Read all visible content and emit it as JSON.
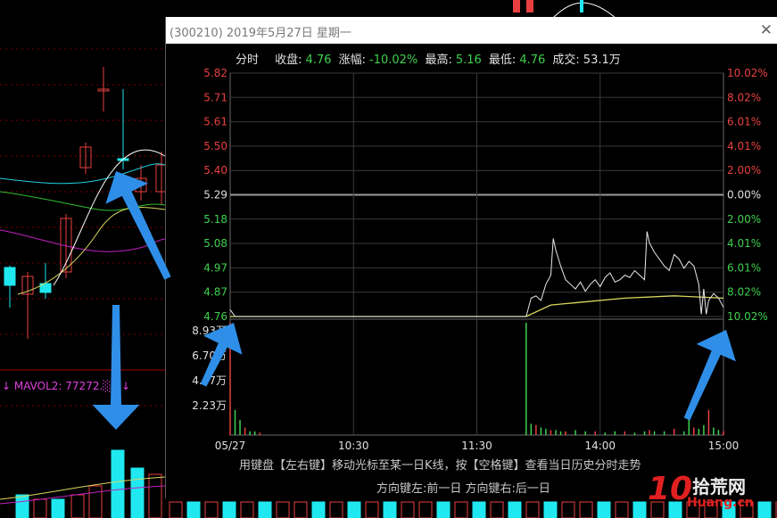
{
  "background": {
    "mavol_label": "↓ MAVOL2: 77272.░0 ↓"
  },
  "popup": {
    "title": "(300210) 2019年5月27日 星期一",
    "close_icon": "close-icon",
    "info": {
      "mode": "分时",
      "close_label": "收盘:",
      "close_value": "4.76",
      "change_label": "涨幅:",
      "change_value": "-10.02%",
      "high_label": "最高:",
      "high_value": "5.16",
      "low_label": "最低:",
      "low_value": "4.76",
      "volume_label": "成交:",
      "volume_value": "53.1万"
    },
    "hint_line1": "用键盘【左右键】移动光标至某一日K线，按【空格键】查看当日历史分时走势",
    "hint_line2": "方向键左:前一日    方向键右:后一日",
    "colors": {
      "up": "#e84040",
      "down": "#3fd04f",
      "neutral": "#e0e0e0",
      "avg_line": "#d8d860",
      "arrow": "#2f8fe8"
    }
  },
  "watermark": {
    "num": "10",
    "cn": "拾荒网",
    "en": "Huang.cn"
  },
  "chart_data": {
    "type": "line",
    "price_ticks_left": [
      "5.82",
      "5.71",
      "5.61",
      "5.50",
      "5.40",
      "5.29",
      "5.18",
      "5.08",
      "4.97",
      "4.87",
      "4.76"
    ],
    "pct_ticks_right": [
      "10.02%",
      "8.02%",
      "6.01%",
      "4.01%",
      "2.00%",
      "0.00%",
      "2.00%",
      "4.01%",
      "6.01%",
      "8.02%",
      "10.02%"
    ],
    "prev_close": 5.29,
    "volume_ticks": [
      "8.93万",
      "6.70万",
      "4.47万",
      "2.23万"
    ],
    "time_ticks": [
      "05/27",
      "10:30",
      "11:30",
      "14:00",
      "15:00"
    ],
    "price_series": [
      [
        0,
        4.79
      ],
      [
        0.01,
        4.76
      ],
      [
        0.6,
        4.76
      ],
      [
        0.61,
        4.84
      ],
      [
        0.62,
        4.85
      ],
      [
        0.63,
        4.83
      ],
      [
        0.64,
        4.9
      ],
      [
        0.65,
        4.94
      ],
      [
        0.655,
        5.1
      ],
      [
        0.66,
        5.05
      ],
      [
        0.67,
        4.98
      ],
      [
        0.68,
        4.92
      ],
      [
        0.69,
        4.9
      ],
      [
        0.7,
        4.88
      ],
      [
        0.71,
        4.91
      ],
      [
        0.72,
        4.87
      ],
      [
        0.73,
        4.9
      ],
      [
        0.74,
        4.92
      ],
      [
        0.75,
        4.89
      ],
      [
        0.76,
        4.93
      ],
      [
        0.77,
        4.95
      ],
      [
        0.78,
        4.91
      ],
      [
        0.79,
        4.92
      ],
      [
        0.8,
        4.94
      ],
      [
        0.81,
        4.93
      ],
      [
        0.82,
        4.96
      ],
      [
        0.83,
        4.94
      ],
      [
        0.84,
        4.92
      ],
      [
        0.845,
        5.13
      ],
      [
        0.85,
        5.08
      ],
      [
        0.86,
        5.04
      ],
      [
        0.87,
        5.01
      ],
      [
        0.88,
        4.98
      ],
      [
        0.89,
        4.96
      ],
      [
        0.9,
        5.03
      ],
      [
        0.91,
        5.01
      ],
      [
        0.92,
        4.97
      ],
      [
        0.93,
        5.0
      ],
      [
        0.94,
        4.98
      ],
      [
        0.95,
        4.9
      ],
      [
        0.955,
        4.77
      ],
      [
        0.96,
        4.88
      ],
      [
        0.965,
        4.77
      ],
      [
        0.97,
        4.83
      ],
      [
        0.98,
        4.86
      ],
      [
        0.99,
        4.84
      ],
      [
        1.0,
        4.8
      ]
    ],
    "avg_series": [
      [
        0,
        4.76
      ],
      [
        0.6,
        4.76
      ],
      [
        0.65,
        4.81
      ],
      [
        0.7,
        4.82
      ],
      [
        0.8,
        4.84
      ],
      [
        0.9,
        4.85
      ],
      [
        1.0,
        4.84
      ]
    ],
    "volume_bars": [
      [
        0.0,
        8.93
      ],
      [
        0.01,
        2.0
      ],
      [
        0.02,
        1.2
      ],
      [
        0.03,
        0.6
      ],
      [
        0.04,
        0.3
      ],
      [
        0.05,
        0.3
      ],
      [
        0.06,
        0.2
      ],
      [
        0.6,
        8.93
      ],
      [
        0.61,
        0.9
      ],
      [
        0.62,
        0.8
      ],
      [
        0.63,
        0.6
      ],
      [
        0.64,
        0.5
      ],
      [
        0.65,
        0.4
      ],
      [
        0.66,
        0.4
      ],
      [
        0.67,
        0.3
      ],
      [
        0.68,
        0.3
      ],
      [
        0.7,
        0.4
      ],
      [
        0.72,
        0.3
      ],
      [
        0.74,
        0.3
      ],
      [
        0.76,
        0.2
      ],
      [
        0.78,
        0.3
      ],
      [
        0.8,
        0.3
      ],
      [
        0.82,
        0.2
      ],
      [
        0.84,
        0.3
      ],
      [
        0.85,
        0.4
      ],
      [
        0.86,
        0.3
      ],
      [
        0.88,
        0.3
      ],
      [
        0.9,
        0.5
      ],
      [
        0.92,
        0.3
      ],
      [
        0.93,
        1.5
      ],
      [
        0.94,
        0.6
      ],
      [
        0.95,
        0.5
      ],
      [
        0.96,
        0.8
      ],
      [
        0.97,
        2.0
      ],
      [
        0.98,
        0.6
      ],
      [
        0.99,
        0.4
      ],
      [
        1.0,
        0.3
      ]
    ]
  }
}
